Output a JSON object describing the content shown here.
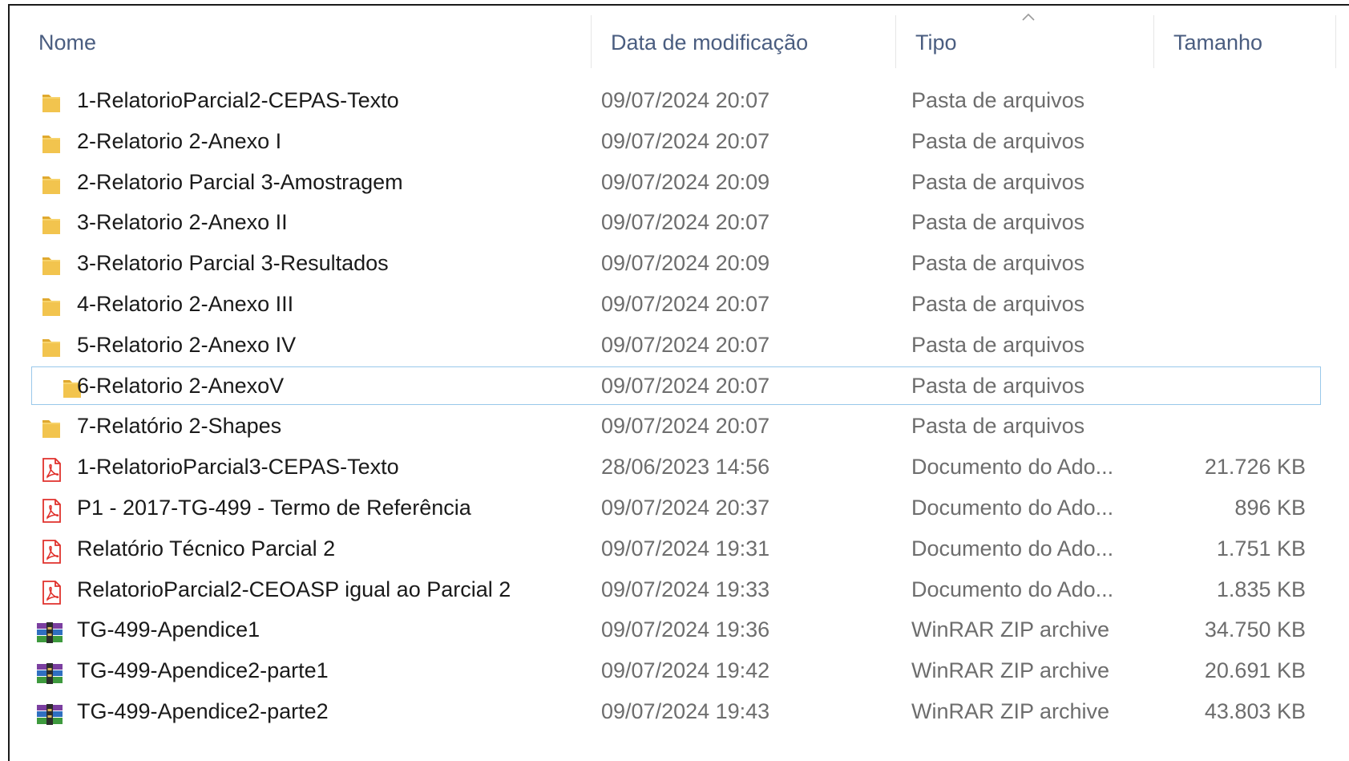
{
  "columns": {
    "name": "Nome",
    "date": "Data de modificação",
    "type": "Tipo",
    "size": "Tamanho"
  },
  "sort": {
    "column": "type",
    "direction": "ascending",
    "icon": "chevron-up-icon"
  },
  "files": [
    {
      "icon": "folder-icon",
      "name": "1-RelatorioParcial2-CEPAS-Texto",
      "date": "09/07/2024 20:07",
      "type": "Pasta de arquivos",
      "size": ""
    },
    {
      "icon": "folder-icon",
      "name": "2-Relatorio 2-Anexo I",
      "date": "09/07/2024 20:07",
      "type": "Pasta de arquivos",
      "size": ""
    },
    {
      "icon": "folder-icon",
      "name": "2-Relatorio Parcial 3-Amostragem",
      "date": "09/07/2024 20:09",
      "type": "Pasta de arquivos",
      "size": ""
    },
    {
      "icon": "folder-icon",
      "name": "3-Relatorio 2-Anexo II",
      "date": "09/07/2024 20:07",
      "type": "Pasta de arquivos",
      "size": ""
    },
    {
      "icon": "folder-icon",
      "name": "3-Relatorio Parcial 3-Resultados",
      "date": "09/07/2024 20:09",
      "type": "Pasta de arquivos",
      "size": ""
    },
    {
      "icon": "folder-icon",
      "name": "4-Relatorio 2-Anexo III",
      "date": "09/07/2024 20:07",
      "type": "Pasta de arquivos",
      "size": ""
    },
    {
      "icon": "folder-icon",
      "name": "5-Relatorio 2-Anexo IV",
      "date": "09/07/2024 20:07",
      "type": "Pasta de arquivos",
      "size": ""
    },
    {
      "icon": "folder-icon",
      "name": "6-Relatorio 2-AnexoV",
      "date": "09/07/2024 20:07",
      "type": "Pasta de arquivos",
      "size": "",
      "selected": true
    },
    {
      "icon": "folder-icon",
      "name": "7-Relatório 2-Shapes",
      "date": "09/07/2024 20:07",
      "type": "Pasta de arquivos",
      "size": ""
    },
    {
      "icon": "pdf-icon",
      "name": "1-RelatorioParcial3-CEPAS-Texto",
      "date": "28/06/2023 14:56",
      "type": "Documento do Ado...",
      "size": "21.726 KB"
    },
    {
      "icon": "pdf-icon",
      "name": "P1 - 2017-TG-499 - Termo de Referência",
      "date": "09/07/2024 20:37",
      "type": "Documento do Ado...",
      "size": "896 KB"
    },
    {
      "icon": "pdf-icon",
      "name": "Relatório Técnico Parcial 2",
      "date": "09/07/2024 19:31",
      "type": "Documento do Ado...",
      "size": "1.751 KB"
    },
    {
      "icon": "pdf-icon",
      "name": "RelatorioParcial2-CEOASP igual ao Parcial 2",
      "date": "09/07/2024 19:33",
      "type": "Documento do Ado...",
      "size": "1.835 KB"
    },
    {
      "icon": "winrar-icon",
      "name": "TG-499-Apendice1",
      "date": "09/07/2024 19:36",
      "type": "WinRAR ZIP archive",
      "size": "34.750 KB"
    },
    {
      "icon": "winrar-icon",
      "name": "TG-499-Apendice2-parte1",
      "date": "09/07/2024 19:42",
      "type": "WinRAR ZIP archive",
      "size": "20.691 KB"
    },
    {
      "icon": "winrar-icon",
      "name": "TG-499-Apendice2-parte2",
      "date": "09/07/2024 19:43",
      "type": "WinRAR ZIP archive",
      "size": "43.803 KB"
    }
  ],
  "colors": {
    "header_text": "#4a5d80",
    "name_text": "#1a1a1a",
    "secondary_text": "#6d6d6d",
    "selection_border": "#99c8ea",
    "folder": "#f2c44e",
    "pdf": "#e0312c"
  }
}
